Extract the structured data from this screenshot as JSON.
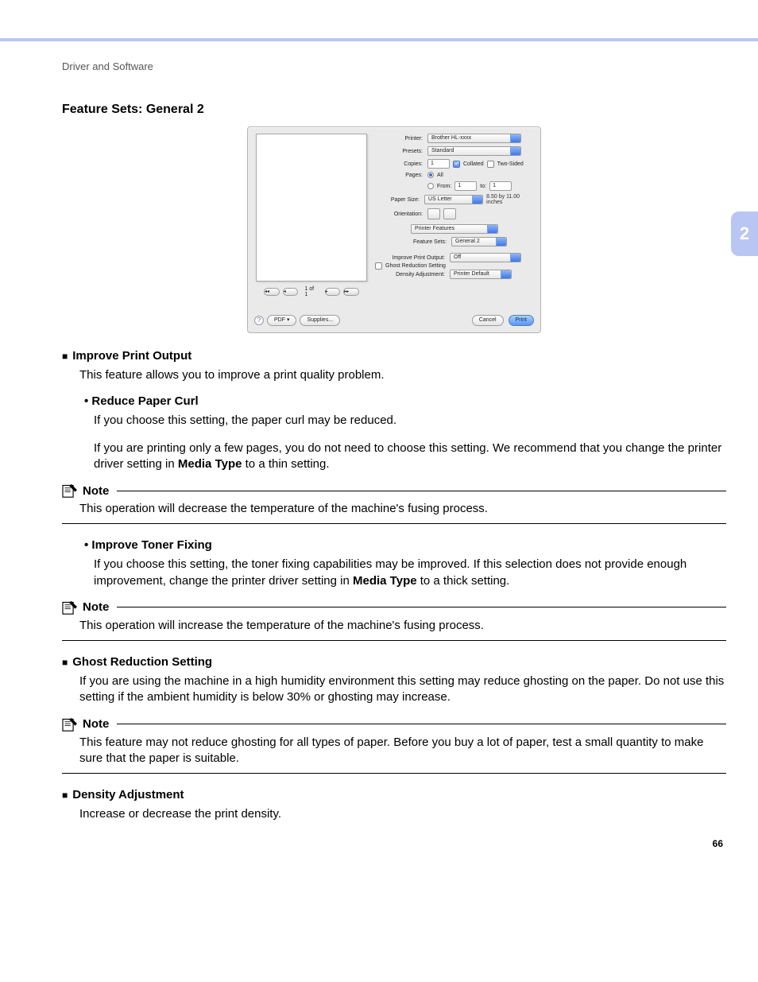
{
  "page": {
    "breadcrumb": "Driver and Software",
    "section_title": "Feature Sets: General 2",
    "chapter": "2",
    "page_number": "66"
  },
  "dialog": {
    "printer_label": "Printer:",
    "printer_value": "Brother HL-xxxx",
    "presets_label": "Presets:",
    "presets_value": "Standard",
    "copies_label": "Copies:",
    "copies_value": "1",
    "collated_label": "Collated",
    "twosided_label": "Two-Sided",
    "pages_label": "Pages:",
    "pages_all": "All",
    "pages_from": "From:",
    "pages_from_val": "1",
    "pages_to": "to:",
    "pages_to_val": "1",
    "papersize_label": "Paper Size:",
    "papersize_value": "US Letter",
    "papersize_hint": "8.50 by 11.00 inches",
    "orientation_label": "Orientation:",
    "panel_value": "Printer Features",
    "featuresets_label": "Feature Sets:",
    "featuresets_value": "General 2",
    "improve_label": "Improve Print Output:",
    "improve_value": "Off",
    "ghost_label": "Ghost Reduction Setting",
    "density_label": "Density Adjustment:",
    "density_value": "Printer Default",
    "pager_text": "1 of 1",
    "help_char": "?",
    "pdf_btn": "PDF ▾",
    "supplies_btn": "Supplies...",
    "cancel_btn": "Cancel",
    "print_btn": "Print"
  },
  "content": {
    "improve_title": "Improve Print Output",
    "improve_desc": "This feature allows you to improve a print quality problem.",
    "reduce_curl_title": "Reduce Paper Curl",
    "reduce_curl_p1": "If you choose this setting, the paper curl may be reduced.",
    "reduce_curl_p2_a": "If you are printing only a few pages, you do not need to choose this setting. We recommend that you change the printer driver setting in ",
    "media_type": "Media Type",
    "reduce_curl_p2_b": " to a thin setting.",
    "note_label": "Note",
    "note1_body": "This operation will decrease the temperature of the machine's fusing process.",
    "toner_fixing_title": "Improve Toner Fixing",
    "toner_fixing_p_a": "If you choose this setting, the toner fixing capabilities may be improved. If this selection does not provide enough improvement, change the printer driver setting in ",
    "toner_fixing_p_b": " to a thick setting.",
    "note2_body": "This operation will increase the temperature of the machine's fusing process.",
    "ghost_title": "Ghost Reduction Setting",
    "ghost_p": "If you are using the machine in a high humidity environment this setting may reduce ghosting on the paper. Do not use this setting if the ambient humidity is below 30% or ghosting may increase.",
    "note3_body": "This feature may not reduce ghosting for all types of paper. Before you buy a lot of paper, test a small quantity to make sure that the paper is suitable.",
    "density_title": "Density Adjustment",
    "density_p": "Increase or decrease the print density."
  }
}
